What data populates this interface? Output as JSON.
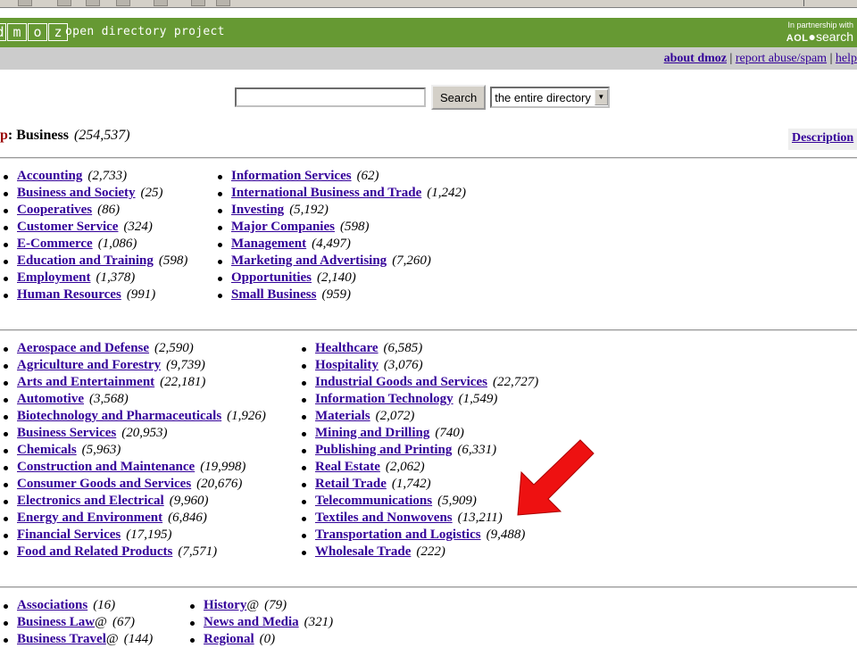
{
  "header": {
    "logo_letters": [
      "d",
      "m",
      "o",
      "z"
    ],
    "tagline": "open directory project",
    "partner_small": "In partnership with",
    "partner_aol": "AOL",
    "partner_search": "search"
  },
  "toplinks": {
    "about": "about dmoz",
    "report": "report abuse/spam",
    "help": "help"
  },
  "search": {
    "button": "Search",
    "scope": "the entire directory"
  },
  "breadcrumb": {
    "top": "p",
    "sep": ": ",
    "current": "Business",
    "count": "(254,537)",
    "description_link": "Description"
  },
  "section1": {
    "left": [
      {
        "label": "Accounting",
        "count": "(2,733)"
      },
      {
        "label": "Business and Society",
        "count": "(25)"
      },
      {
        "label": "Cooperatives",
        "count": "(86)"
      },
      {
        "label": "Customer Service",
        "count": "(324)"
      },
      {
        "label": "E-Commerce",
        "count": "(1,086)"
      },
      {
        "label": "Education and Training",
        "count": "(598)"
      },
      {
        "label": "Employment",
        "count": "(1,378)"
      },
      {
        "label": "Human Resources",
        "count": "(991)"
      }
    ],
    "right": [
      {
        "label": "Information Services",
        "count": "(62)"
      },
      {
        "label": "International Business and Trade",
        "count": "(1,242)"
      },
      {
        "label": "Investing",
        "count": "(5,192)"
      },
      {
        "label": "Major Companies",
        "count": "(598)"
      },
      {
        "label": "Management",
        "count": "(4,497)"
      },
      {
        "label": "Marketing and Advertising",
        "count": "(7,260)"
      },
      {
        "label": "Opportunities",
        "count": "(2,140)"
      },
      {
        "label": "Small Business",
        "count": "(959)"
      }
    ]
  },
  "section2": {
    "left": [
      {
        "label": "Aerospace and Defense",
        "count": "(2,590)"
      },
      {
        "label": "Agriculture and Forestry",
        "count": "(9,739)"
      },
      {
        "label": "Arts and Entertainment",
        "count": "(22,181)"
      },
      {
        "label": "Automotive",
        "count": "(3,568)"
      },
      {
        "label": "Biotechnology and Pharmaceuticals",
        "count": "(1,926)"
      },
      {
        "label": "Business Services",
        "count": "(20,953)"
      },
      {
        "label": "Chemicals",
        "count": "(5,963)"
      },
      {
        "label": "Construction and Maintenance",
        "count": "(19,998)"
      },
      {
        "label": "Consumer Goods and Services",
        "count": "(20,676)"
      },
      {
        "label": "Electronics and Electrical",
        "count": "(9,960)"
      },
      {
        "label": "Energy and Environment",
        "count": "(6,846)"
      },
      {
        "label": "Financial Services",
        "count": "(17,195)"
      },
      {
        "label": "Food and Related Products",
        "count": "(7,571)"
      }
    ],
    "right": [
      {
        "label": "Healthcare",
        "count": "(6,585)"
      },
      {
        "label": "Hospitality",
        "count": "(3,076)"
      },
      {
        "label": "Industrial Goods and Services",
        "count": "(22,727)"
      },
      {
        "label": "Information Technology",
        "count": "(1,549)"
      },
      {
        "label": "Materials",
        "count": "(2,072)"
      },
      {
        "label": "Mining and Drilling",
        "count": "(740)"
      },
      {
        "label": "Publishing and Printing",
        "count": "(6,331)"
      },
      {
        "label": "Real Estate",
        "count": "(2,062)"
      },
      {
        "label": "Retail Trade",
        "count": "(1,742)"
      },
      {
        "label": "Telecommunications",
        "count": "(5,909)"
      },
      {
        "label": "Textiles and Nonwovens",
        "count": "(13,211)"
      },
      {
        "label": "Transportation and Logistics",
        "count": "(9,488)"
      },
      {
        "label": "Wholesale Trade",
        "count": "(222)"
      }
    ]
  },
  "section3": {
    "left": [
      {
        "label": "Associations",
        "at": "",
        "count": "(16)"
      },
      {
        "label": "Business Law",
        "at": "@",
        "count": "(67)"
      },
      {
        "label": "Business Travel",
        "at": "@",
        "count": "(144)"
      }
    ],
    "right": [
      {
        "label": "History",
        "at": "@",
        "count": "(79)"
      },
      {
        "label": "News and Media",
        "at": "",
        "count": "(321)"
      },
      {
        "label": "Regional",
        "at": "",
        "count": "(0)"
      }
    ]
  },
  "annotation": {
    "arrow_color": "#ee1111"
  }
}
